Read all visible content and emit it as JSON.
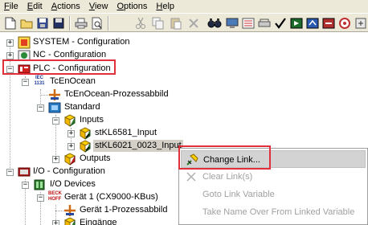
{
  "menubar": {
    "items": [
      {
        "label": "File",
        "ul": "F",
        "rest": "ile"
      },
      {
        "label": "Edit",
        "ul": "E",
        "rest": "dit"
      },
      {
        "label": "Actions",
        "ul": "A",
        "rest": "ctions"
      },
      {
        "label": "View",
        "ul": "V",
        "rest": "iew"
      },
      {
        "label": "Options",
        "ul": "O",
        "rest": "ptions"
      },
      {
        "label": "Help",
        "ul": "H",
        "rest": "elp"
      }
    ]
  },
  "toolbar": {
    "icons": [
      "new-file-icon",
      "open-folder-icon",
      "save-icon",
      "save-as-icon",
      "print-icon",
      "print-preview-icon",
      "cut-icon",
      "copy-icon",
      "paste-icon",
      "delete-icon",
      "find-icon",
      "monitor-icon",
      "sort-icon",
      "network-icon",
      "activate-check-icon",
      "run-mode-icon",
      "config-mode-icon",
      "scan-icon",
      "target-icon"
    ]
  },
  "tree": {
    "system": "SYSTEM - Configuration",
    "nc": "NC - Configuration",
    "plc": "PLC - Configuration",
    "plc_badge": "IEC 1131",
    "tcenocean": "TcEnOcean",
    "tcenocean_image": "TcEnOcean-Prozessabbild",
    "standard": "Standard",
    "inputs": "Inputs",
    "input1": "stKL6581_Input",
    "input2": "stKL6021_0023_Input",
    "outputs": "Outputs",
    "io": "I/O - Configuration",
    "io_devices": "I/O Devices",
    "beckhoff_badge": "BECK HOFF",
    "device1": "Gerät 1 (CX9000-KBus)",
    "device1_image": "Gerät 1-Prozessabbild",
    "eingaenge": "Eingänge"
  },
  "context_menu": {
    "change_link": "Change Link...",
    "change_link_ul": "L",
    "clear_links": "Clear Link(s)",
    "goto_link": "Goto Link Variable",
    "take_name": "Take Name Over From Linked Variable"
  },
  "colors": {
    "highlight_red": "#e0303c",
    "menu_bg": "#ece9d8",
    "disabled_text": "#a0a0a0",
    "selection_bg": "#d4d0c8"
  }
}
